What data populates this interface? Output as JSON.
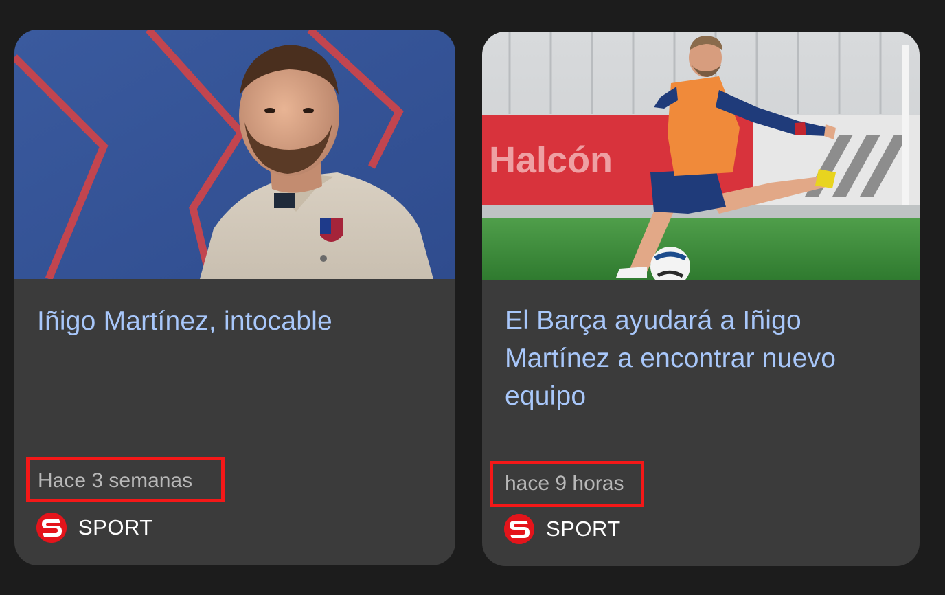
{
  "cards": [
    {
      "headline": "Iñigo Martínez, intocable",
      "time": "Hace 3 semanas",
      "source": {
        "name": "SPORT",
        "icon": "sport-logo-icon"
      },
      "image": "player-portrait-photo"
    },
    {
      "headline": "El Barça ayudará a Iñigo Martínez a encontrar nuevo equipo",
      "time": "hace 9 horas",
      "source": {
        "name": "SPORT",
        "icon": "sport-logo-icon"
      },
      "image": "player-kicking-ball-photo",
      "banner_text": "Halcón"
    }
  ],
  "colors": {
    "background": "#1c1c1c",
    "card": "#3b3b3b",
    "headline": "#a8c7fa",
    "time": "#b8b8b8",
    "highlight": "#f41818",
    "sport_red": "#e4141b"
  }
}
